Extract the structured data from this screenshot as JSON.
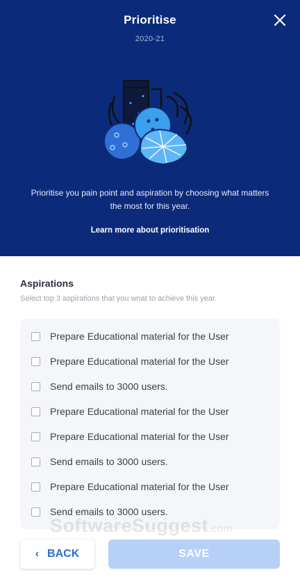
{
  "header": {
    "title": "Prioritise",
    "year": "2020-21",
    "description": "Prioritise you pain point and aspiration by choosing what matters the most for this year.",
    "learn_more": "Learn more about prioritisation",
    "close_icon": "close-icon",
    "illustration_icon": "plant-spheres-illustration",
    "background_color": "#0b2b7a"
  },
  "aspirations": {
    "title": "Aspirations",
    "subtitle": "Select top 3 aspirations that you wnat to achieve this year.",
    "items": [
      {
        "label": "Prepare Educational material for the User",
        "checked": false
      },
      {
        "label": "Prepare Educational material for the User",
        "checked": false
      },
      {
        "label": "Send emails to 3000 users.",
        "checked": false
      },
      {
        "label": "Prepare Educational material for the User",
        "checked": false
      },
      {
        "label": "Prepare Educational material for the User",
        "checked": false
      },
      {
        "label": "Send emails to 3000 users.",
        "checked": false
      },
      {
        "label": "Prepare Educational material for the User",
        "checked": false
      },
      {
        "label": "Send emails to 3000 users.",
        "checked": false
      }
    ]
  },
  "watermark": {
    "brand": "SoftwareSuggest",
    "suffix": ".com"
  },
  "footer": {
    "back_label": "BACK",
    "back_icon": "chevron-left-icon",
    "save_label": "SAVE",
    "accent_color": "#2b6fd6",
    "save_disabled_color": "#b7d0f7"
  }
}
